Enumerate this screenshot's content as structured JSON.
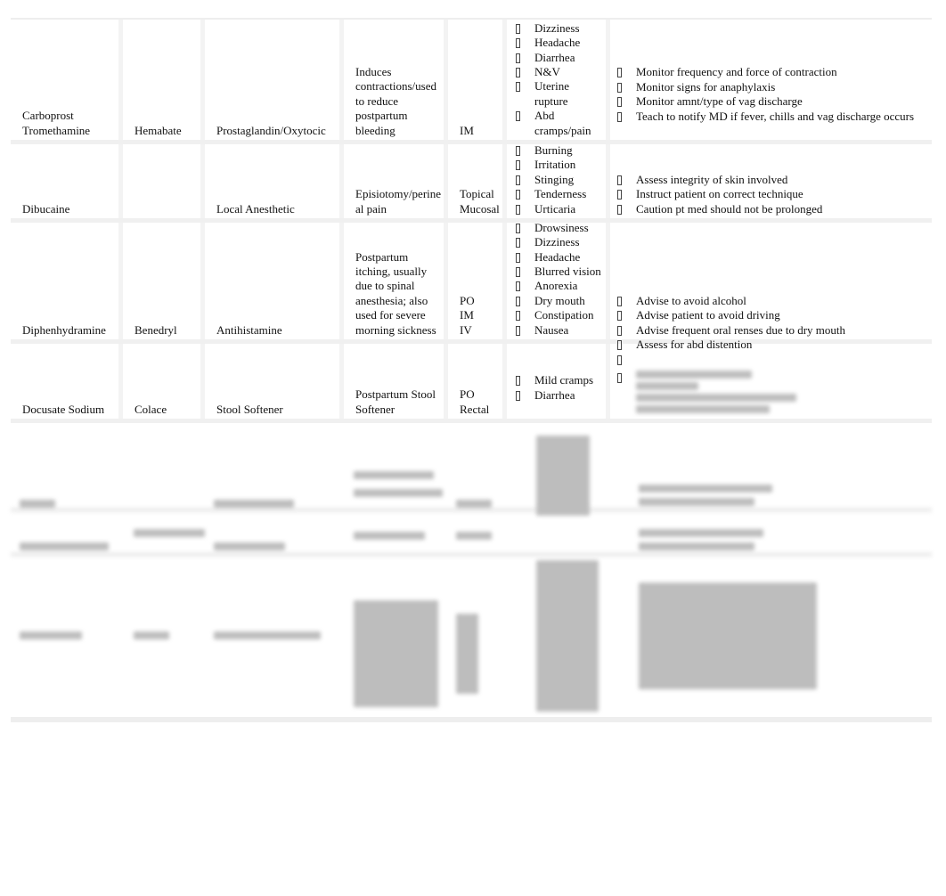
{
  "rows": [
    {
      "generic": "Carboprost Tromethamine",
      "brand": "Hemabate",
      "class": "Prostaglandin/Oxytocic",
      "indication": "Induces contractions/used to reduce postpartum bleeding",
      "route": "IM",
      "side_effects": [
        "Dizziness",
        "Headache",
        "Diarrhea",
        "N&V",
        "Uterine rupture",
        "Abd cramps/pain"
      ],
      "nursing": [
        "Monitor frequency and force of contraction",
        "Monitor signs for anaphylaxis",
        "Monitor amnt/type of vag discharge",
        "Teach to notify MD if fever, chills and vag discharge occurs"
      ]
    },
    {
      "generic": "Dibucaine",
      "brand": "",
      "class": "Local Anesthetic",
      "indication": "Episiotomy/perineal pain",
      "route": "Topical Mucosal",
      "side_effects": [
        "Burning",
        "Irritation",
        "Stinging",
        "Tenderness",
        "Urticaria"
      ],
      "nursing": [
        "Assess integrity of skin involved",
        "Instruct patient on correct technique",
        "Caution pt med should not be prolonged"
      ]
    },
    {
      "generic": "Diphenhydramine",
      "brand": "Benedryl",
      "class": "Antihistamine",
      "indication": "Postpartum itching, usually due to spinal anesthesia; also used for severe morning sickness",
      "route": "PO IM IV",
      "side_effects": [
        "Drowsiness",
        "Dizziness",
        "Headache",
        "Blurred vision",
        "Anorexia",
        "Dry mouth",
        "Constipation",
        "Nausea"
      ],
      "nursing": [
        "Advise to avoid alcohol",
        "Advise patient to avoid driving",
        "Advise frequent oral renses due to dry mouth"
      ]
    },
    {
      "generic": "Docusate Sodium",
      "brand": "Colace",
      "class": "Stool Softener",
      "indication": "Postpartum Stool Softener",
      "route": "PO Rectal",
      "side_effects": [
        "Mild cramps",
        "Diarrhea"
      ],
      "nursing": [
        "Assess for abd distention",
        ""
      ]
    }
  ],
  "bullet_icon": "missing-glyph-box"
}
